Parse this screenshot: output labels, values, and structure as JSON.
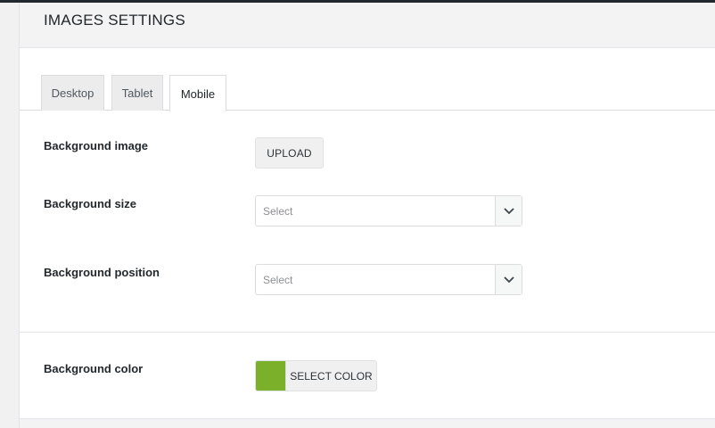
{
  "panel": {
    "title": "IMAGES SETTINGS"
  },
  "tabs": [
    {
      "label": "Desktop",
      "active": false
    },
    {
      "label": "Tablet",
      "active": false
    },
    {
      "label": "Mobile",
      "active": true
    }
  ],
  "fields": {
    "background_image": {
      "label": "Background image",
      "button_label": "UPLOAD"
    },
    "background_size": {
      "label": "Background size",
      "placeholder": "Select"
    },
    "background_position": {
      "label": "Background position",
      "placeholder": "Select"
    },
    "background_color": {
      "label": "Background color",
      "button_label": "SELECT COLOR",
      "swatch_color": "#7bb12a"
    }
  },
  "icons": {
    "select_arrow": "chevron-down-icon"
  }
}
